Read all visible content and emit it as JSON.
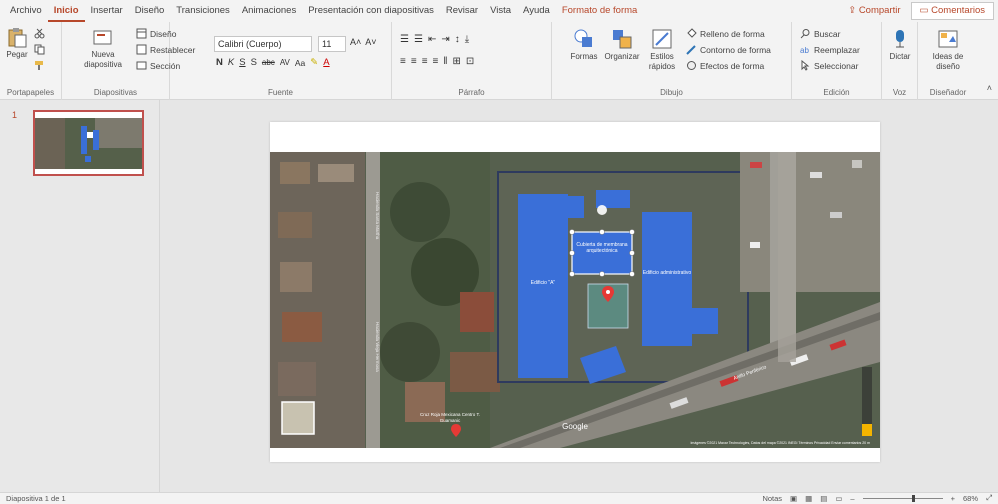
{
  "tabs": [
    "Archivo",
    "Inicio",
    "Insertar",
    "Diseño",
    "Transiciones",
    "Animaciones",
    "Presentación con diapositivas",
    "Revisar",
    "Vista",
    "Ayuda",
    "Formato de forma"
  ],
  "active_tab": "Inicio",
  "share_label": "Compartir",
  "comments_label": "Comentarios",
  "ribbon": {
    "clipboard": {
      "paste": "Pegar",
      "label": "Portapapeles"
    },
    "slides": {
      "new_slide": "Nueva diapositiva",
      "layout": "Diseño",
      "reset": "Restablecer",
      "section": "Sección",
      "label": "Diapositivas"
    },
    "font": {
      "name": "Calibri (Cuerpo)",
      "size": "11",
      "label": "Fuente",
      "formats": [
        "N",
        "K",
        "S",
        "S",
        "abc",
        "AV",
        "Aa"
      ]
    },
    "paragraph": {
      "label": "Párrafo"
    },
    "drawing": {
      "shapes": "Formas",
      "arrange": "Organizar",
      "quick_styles": "Estilos rápidos",
      "fill": "Relleno de forma",
      "outline": "Contorno de forma",
      "effects": "Efectos de forma",
      "label": "Dibujo"
    },
    "editing": {
      "find": "Buscar",
      "replace": "Reemplazar",
      "select": "Seleccionar",
      "label": "Edición"
    },
    "voice": {
      "dictate": "Dictar",
      "label": "Voz"
    },
    "designer": {
      "ideas": "Ideas de diseño",
      "label": "Diseñador"
    }
  },
  "thumbnail": {
    "number": "1"
  },
  "slide": {
    "buildings": [
      {
        "label": "Edificio \"A\""
      },
      {
        "label": "Edificio administrativo"
      },
      {
        "label": "Cubierta de membrana arquitectónica"
      }
    ],
    "map_labels": {
      "street_left": "Hacienda Santa Martha",
      "street_mid": "Hacienda Vieja Hermosa",
      "poi": "Cruz Roja Mexicana Centro T. Guamanic",
      "road": "Anillo Periférico",
      "google": "Google",
      "attribution": "Imágenes ©2021 Maxar Technologies, Datos del mapa ©2021 INEGI   Términos   Privacidad   Enviar comentarios   20 m"
    }
  },
  "status": {
    "slide_info": "Diapositiva 1 de 1",
    "notes": "Notas",
    "zoom": "68%",
    "zoom_fraction": 0.62
  },
  "colors": {
    "accent": "#b7472a",
    "building_blue": "#3a6fd8",
    "selection": "#c0504d"
  }
}
